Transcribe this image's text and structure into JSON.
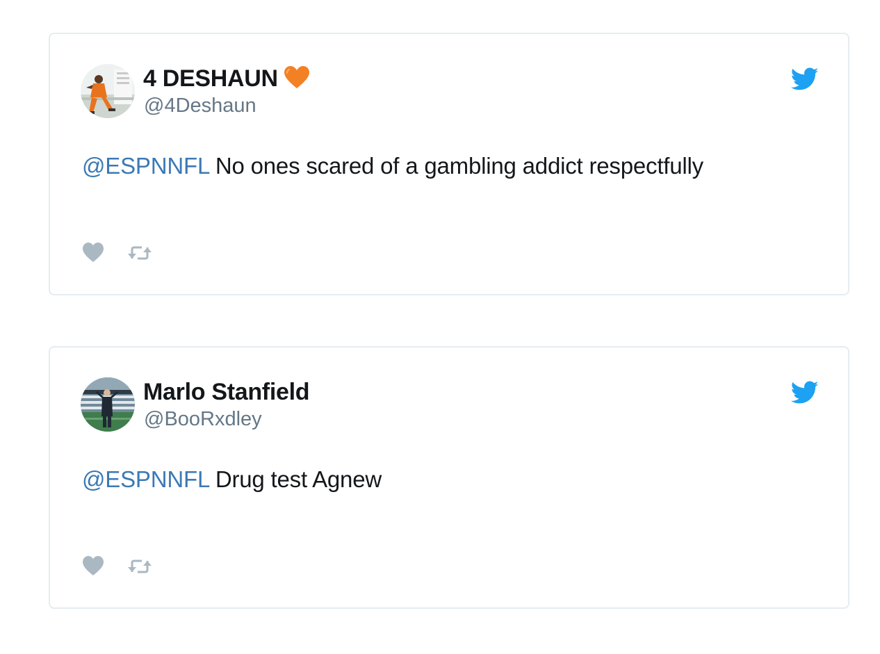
{
  "colors": {
    "card_border": "#e6ecf0",
    "name": "#14171a",
    "handle": "#657786",
    "mention": "#3b79b5",
    "twitter_blue": "#1da1f2",
    "action_icon": "#aab8c2"
  },
  "tweets": [
    {
      "display_name": "4 DESHAUN",
      "name_emoji": "orange-heart-icon",
      "handle": "@4Deshaun",
      "mention": "@ESPNNFL",
      "text": " No ones scared of a gambling addict respectfully",
      "avatar": "player-photo-avatar",
      "icons": [
        "twitter-bird-icon",
        "heart-icon",
        "retweet-icon"
      ]
    },
    {
      "display_name": "Marlo Stanfield",
      "handle": "@BooRxdley",
      "mention": "@ESPNNFL",
      "text": " Drug test Agnew",
      "avatar": "stadium-photo-avatar",
      "icons": [
        "twitter-bird-icon",
        "heart-icon",
        "retweet-icon"
      ]
    }
  ]
}
